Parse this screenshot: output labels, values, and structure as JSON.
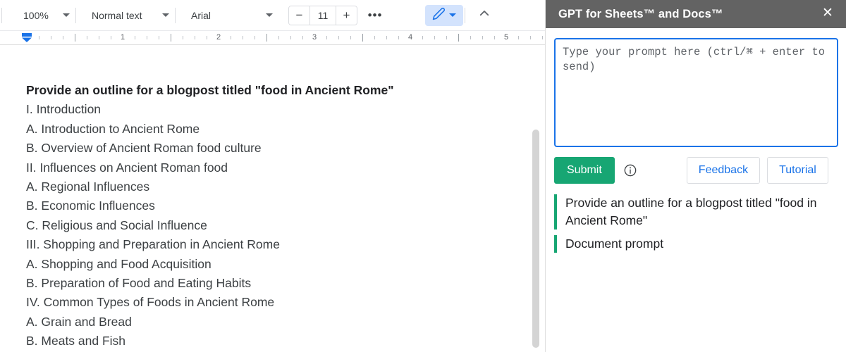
{
  "toolbar": {
    "zoom": "100%",
    "paragraph_style": "Normal text",
    "font": "Arial",
    "font_size": "11",
    "decrease_label": "−",
    "increase_label": "+",
    "more_label": "•••",
    "edit_mode_icon": "pencil-icon",
    "collapse_icon": "chevron-up-icon"
  },
  "ruler": {
    "numbers": [
      "1",
      "2",
      "3",
      "4",
      "5"
    ]
  },
  "document": {
    "lines": [
      {
        "text": "Provide an outline for a blogpost titled \"food in Ancient Rome\"",
        "bold": true
      },
      {
        "text": "I. Introduction",
        "bold": false
      },
      {
        "text": "A. Introduction to Ancient Rome",
        "bold": false
      },
      {
        "text": "B. Overview of Ancient Roman food culture",
        "bold": false
      },
      {
        "text": "II. Influences on Ancient Roman food",
        "bold": false
      },
      {
        "text": "A. Regional Influences",
        "bold": false
      },
      {
        "text": "B. Economic Influences",
        "bold": false
      },
      {
        "text": "C. Religious and Social Influence",
        "bold": false
      },
      {
        "text": "III. Shopping and Preparation in Ancient Rome",
        "bold": false
      },
      {
        "text": "A. Shopping and Food Acquisition",
        "bold": false
      },
      {
        "text": "B. Preparation of Food and Eating Habits",
        "bold": false
      },
      {
        "text": "IV. Common Types of Foods in Ancient Rome",
        "bold": false
      },
      {
        "text": "A. Grain and Bread",
        "bold": false
      },
      {
        "text": "B. Meats and Fish",
        "bold": false
      }
    ]
  },
  "panel": {
    "title": "GPT for Sheets™ and Docs™",
    "close_label": "✕",
    "prompt_placeholder": "Type your prompt here (ctrl/⌘ + enter to send)",
    "prompt_value": "",
    "submit_label": "Submit",
    "info_icon": "info-icon",
    "feedback_label": "Feedback",
    "tutorial_label": "Tutorial",
    "history": [
      {
        "text": "Provide an outline for a blogpost titled \"food in Ancient Rome\""
      },
      {
        "text": "Document prompt"
      }
    ]
  },
  "colors": {
    "panel_header_bg": "#636363",
    "submit_green": "#17a673",
    "accent_blue": "#1a73e8",
    "edit_mode_bg": "#d3e3fd"
  }
}
